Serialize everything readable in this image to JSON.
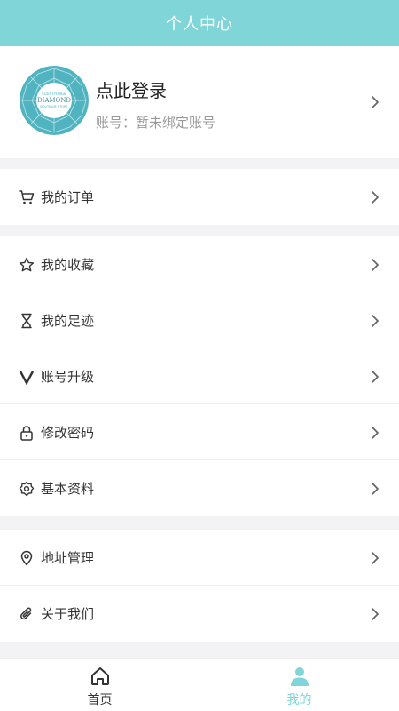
{
  "header": {
    "title": "个人中心"
  },
  "profile": {
    "login_label": "点此登录",
    "account_label": "账号：暂未绑定账号",
    "avatar_icon": "diamond-logo",
    "avatar_text_top": "LOUXTYONGE",
    "avatar_text_main": "DIAMOND",
    "avatar_text_sub": "BOUTIQUE STORE"
  },
  "menu": {
    "orders": {
      "label": "我的订单",
      "icon": "cart-icon"
    },
    "favorites": {
      "label": "我的收藏",
      "icon": "star-icon"
    },
    "history": {
      "label": "我的足迹",
      "icon": "hourglass-icon"
    },
    "upgrade": {
      "label": "账号升级",
      "icon": "v-icon"
    },
    "password": {
      "label": "修改密码",
      "icon": "lock-icon"
    },
    "profile_info": {
      "label": "基本资料",
      "icon": "gear-icon"
    },
    "address": {
      "label": "地址管理",
      "icon": "location-icon"
    },
    "about": {
      "label": "关于我们",
      "icon": "paperclip-icon"
    }
  },
  "tabbar": {
    "home": {
      "label": "首页",
      "icon": "home-icon"
    },
    "mine": {
      "label": "我的",
      "icon": "user-icon",
      "active": true
    }
  },
  "colors": {
    "accent": "#7fd5d7",
    "background": "#f3f2f5",
    "text": "#333333",
    "muted": "#999999"
  }
}
